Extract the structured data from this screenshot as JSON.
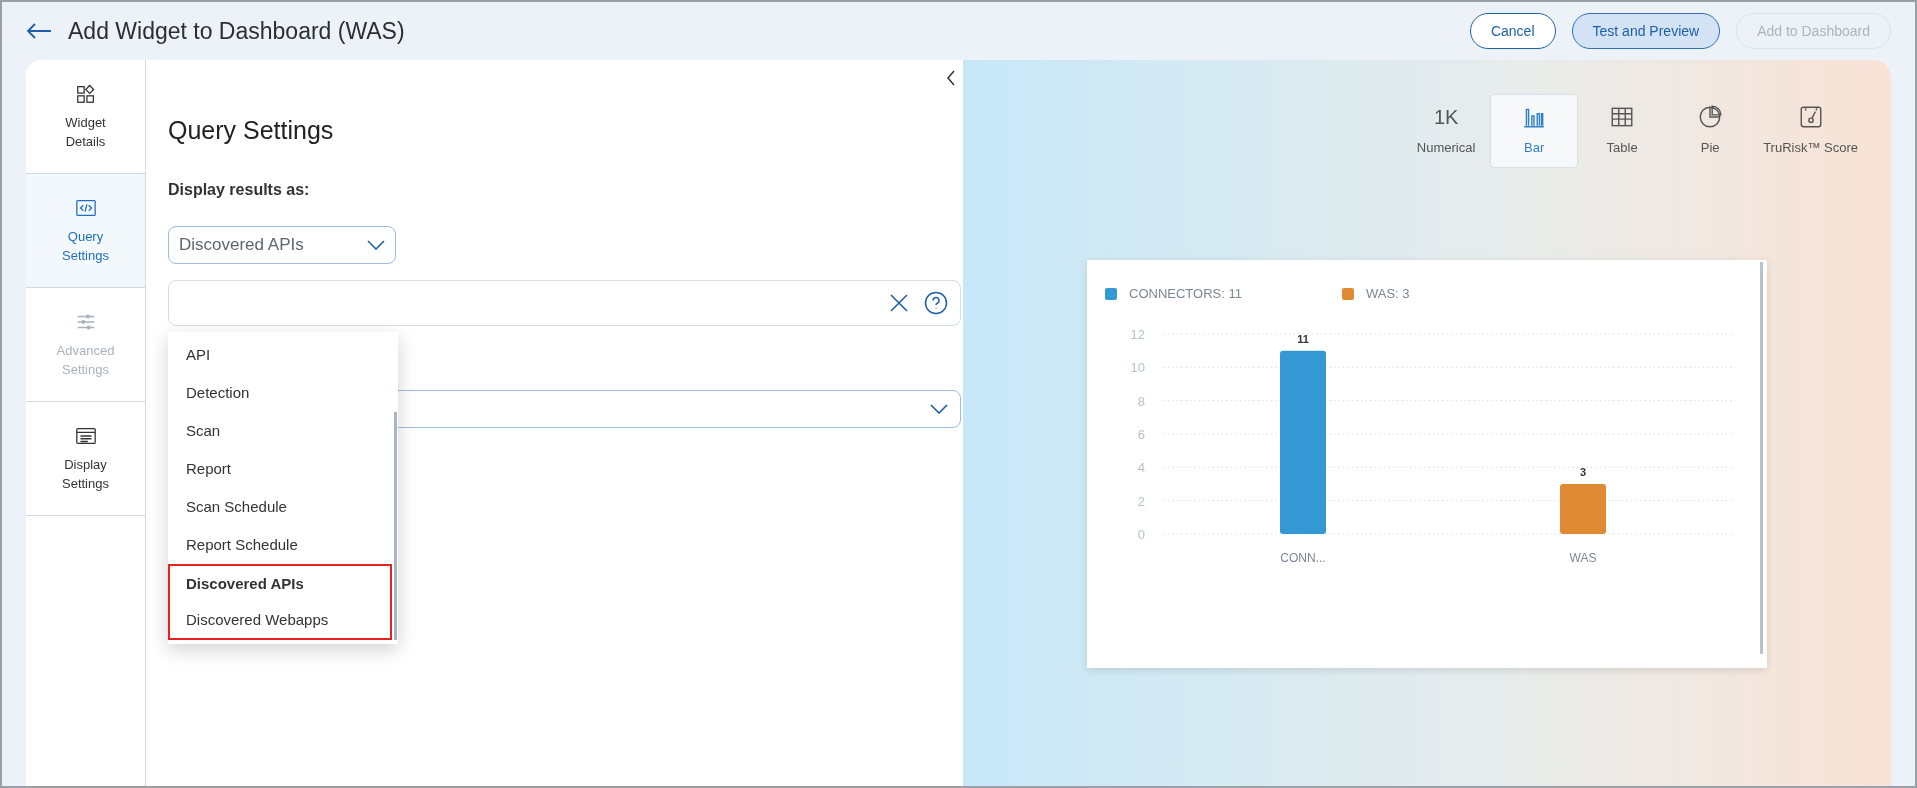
{
  "header": {
    "title": "Add Widget to Dashboard (WAS)",
    "buttons": [
      {
        "label": "Cancel",
        "kind": "outline",
        "disabled": false
      },
      {
        "label": "Test and Preview",
        "kind": "filled",
        "disabled": false
      },
      {
        "label": "Add to Dashboard",
        "kind": "outline",
        "disabled": true
      }
    ]
  },
  "sidebar": {
    "items": [
      {
        "label": "Widget Details",
        "selected": false,
        "disabled": false
      },
      {
        "label": "Query Settings",
        "selected": true,
        "disabled": false
      },
      {
        "label": "Advanced Settings",
        "selected": false,
        "disabled": true
      },
      {
        "label": "Display Settings",
        "selected": false,
        "disabled": false
      }
    ]
  },
  "panel": {
    "title": "Query Settings",
    "display_label": "Display results as:",
    "select": {
      "value": "Discovered APIs"
    },
    "menu": [
      {
        "label": "API",
        "selected": false,
        "highlighted": false
      },
      {
        "label": "Detection",
        "selected": false,
        "highlighted": false
      },
      {
        "label": "Scan",
        "selected": false,
        "highlighted": false
      },
      {
        "label": "Report",
        "selected": false,
        "highlighted": false
      },
      {
        "label": "Scan Schedule",
        "selected": false,
        "highlighted": false
      },
      {
        "label": "Report Schedule",
        "selected": false,
        "highlighted": false
      },
      {
        "label": "Discovered APIs",
        "selected": true,
        "highlighted": true
      },
      {
        "label": "Discovered Webapps",
        "selected": false,
        "highlighted": true
      }
    ]
  },
  "preview": {
    "viz_types": [
      {
        "label": "Numerical",
        "glyph": "1K",
        "selected": false
      },
      {
        "label": "Bar",
        "selected": true
      },
      {
        "label": "Table",
        "selected": false
      },
      {
        "label": "Pie",
        "selected": false
      },
      {
        "label": "TruRisk™ Score",
        "selected": false
      }
    ],
    "chart_data": {
      "type": "bar",
      "categories": [
        "CONN...",
        "WAS"
      ],
      "series": [
        {
          "name": "CONNECTORS: 11",
          "color": "#3498d4",
          "values": [
            11,
            null
          ]
        },
        {
          "name": "WAS: 3",
          "color": "#e08a33",
          "values": [
            null,
            3
          ]
        }
      ],
      "ylim": [
        0,
        12
      ],
      "yticks": [
        0,
        2,
        4,
        6,
        8,
        10,
        12
      ],
      "grid": true,
      "data_labels": true
    }
  }
}
